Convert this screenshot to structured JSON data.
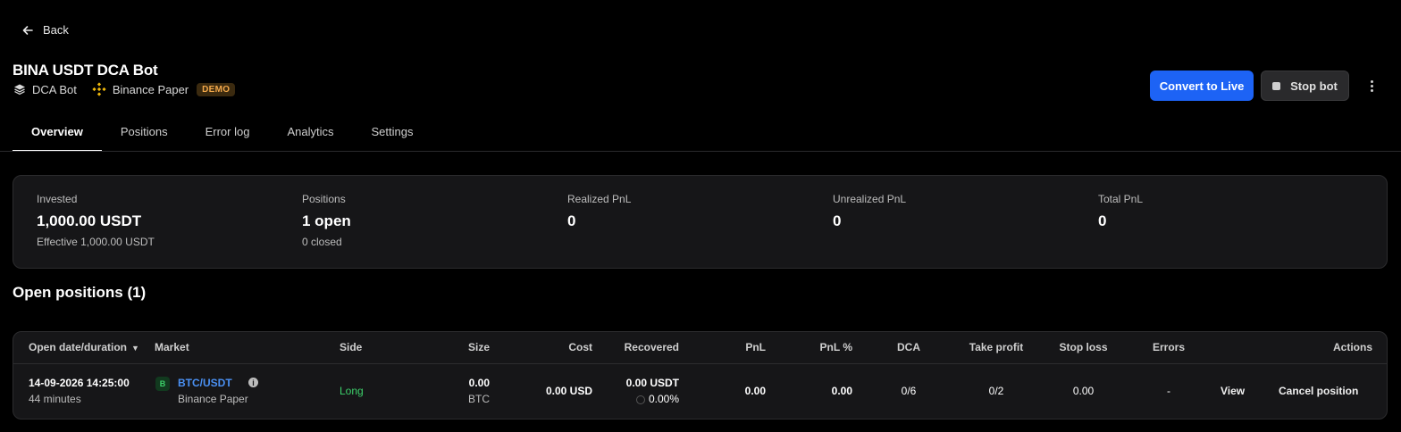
{
  "nav": {
    "back_label": "Back"
  },
  "bot": {
    "title": "BINA USDT DCA Bot",
    "type_label": "DCA Bot",
    "exchange_label": "Binance Paper",
    "badge": "DEMO"
  },
  "actions": {
    "convert_label": "Convert to Live",
    "stop_label": "Stop bot"
  },
  "tabs": [
    {
      "label": "Overview"
    },
    {
      "label": "Positions"
    },
    {
      "label": "Error log"
    },
    {
      "label": "Analytics"
    },
    {
      "label": "Settings"
    }
  ],
  "stats": {
    "invested": {
      "label": "Invested",
      "value": "1,000.00 USDT",
      "sub": "Effective 1,000.00 USDT"
    },
    "positions": {
      "label": "Positions",
      "value": "1 open",
      "sub": "0 closed"
    },
    "realized": {
      "label": "Realized PnL",
      "value": "0"
    },
    "unrealized": {
      "label": "Unrealized PnL",
      "value": "0"
    },
    "total": {
      "label": "Total PnL",
      "value": "0"
    }
  },
  "open_positions": {
    "title": "Open positions (1)",
    "columns": {
      "open_date": "Open date/duration",
      "market": "Market",
      "side": "Side",
      "size": "Size",
      "cost": "Cost",
      "recovered": "Recovered",
      "pnl": "PnL",
      "pnl_pct": "PnL %",
      "dca": "DCA",
      "take_profit": "Take profit",
      "stop_loss": "Stop loss",
      "errors": "Errors",
      "actions": "Actions"
    },
    "rows": [
      {
        "open_date": "14-09-2026 14:25:00",
        "duration": "44 minutes",
        "exchange_badge": "B",
        "market": "BTC/USDT",
        "exchange": "Binance Paper",
        "side": "Long",
        "size": "0.00",
        "size_unit": "BTC",
        "cost": "0.00 USD",
        "recovered": "0.00 USDT",
        "recovered_pct": "0.00%",
        "pnl": "0.00",
        "pnl_pct": "0.00",
        "dca": "0/6",
        "take_profit": "0/2",
        "stop_loss": "0.00",
        "errors": "-",
        "view_label": "View",
        "cancel_label": "Cancel position"
      }
    ]
  },
  "colors": {
    "accent": "#1d63f5",
    "long": "#3dd16b",
    "link": "#4a90f2",
    "demo_text": "#f3a84a"
  }
}
